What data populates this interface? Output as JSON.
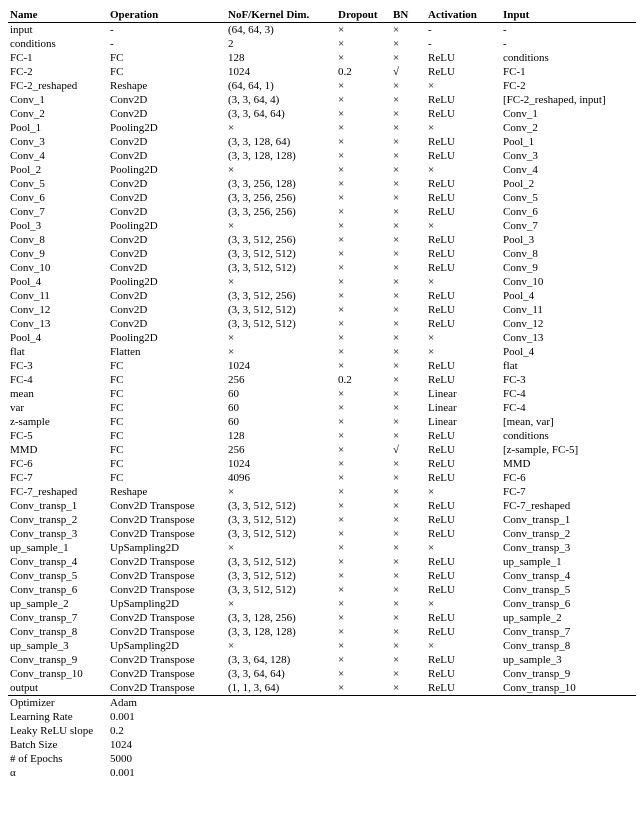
{
  "headers": {
    "name": "Name",
    "operation": "Operation",
    "nof": "NoF/Kernel Dim.",
    "dropout": "Dropout",
    "bn": "BN",
    "activation": "Activation",
    "input": "Input"
  },
  "rows": [
    {
      "name": "input",
      "op": "-",
      "nof": "(64, 64, 3)",
      "dropout": "×",
      "bn": "×",
      "act": "-",
      "inp": "-"
    },
    {
      "name": "conditions",
      "op": "-",
      "nof": "2",
      "dropout": "×",
      "bn": "×",
      "act": "-",
      "inp": "-"
    },
    {
      "name": "FC-1",
      "op": "FC",
      "nof": "128",
      "dropout": "×",
      "bn": "×",
      "act": "ReLU",
      "inp": "conditions"
    },
    {
      "name": "FC-2",
      "op": "FC",
      "nof": "1024",
      "dropout": "0.2",
      "bn": "√",
      "act": "ReLU",
      "inp": "FC-1"
    },
    {
      "name": "FC-2_reshaped",
      "op": "Reshape",
      "nof": "(64, 64, 1)",
      "dropout": "×",
      "bn": "×",
      "act": "×",
      "inp": "FC-2"
    },
    {
      "name": "Conv_1",
      "op": "Conv2D",
      "nof": "(3, 3, 64, 4)",
      "dropout": "×",
      "bn": "×",
      "act": "ReLU",
      "inp": "[FC-2_reshaped, input]"
    },
    {
      "name": "Conv_2",
      "op": "Conv2D",
      "nof": "(3, 3, 64, 64)",
      "dropout": "×",
      "bn": "×",
      "act": "ReLU",
      "inp": "Conv_1"
    },
    {
      "name": "Pool_1",
      "op": "Pooling2D",
      "nof": "×",
      "dropout": "×",
      "bn": "×",
      "act": "×",
      "inp": "Conv_2"
    },
    {
      "name": "Conv_3",
      "op": "Conv2D",
      "nof": "(3, 3, 128, 64)",
      "dropout": "×",
      "bn": "×",
      "act": "ReLU",
      "inp": "Pool_1"
    },
    {
      "name": "Conv_4",
      "op": "Conv2D",
      "nof": "(3, 3, 128, 128)",
      "dropout": "×",
      "bn": "×",
      "act": "ReLU",
      "inp": "Conv_3"
    },
    {
      "name": "Pool_2",
      "op": "Pooling2D",
      "nof": "×",
      "dropout": "×",
      "bn": "×",
      "act": "×",
      "inp": "Conv_4"
    },
    {
      "name": "Conv_5",
      "op": "Conv2D",
      "nof": "(3, 3, 256, 128)",
      "dropout": "×",
      "bn": "×",
      "act": "ReLU",
      "inp": "Pool_2"
    },
    {
      "name": "Conv_6",
      "op": "Conv2D",
      "nof": "(3, 3, 256, 256)",
      "dropout": "×",
      "bn": "×",
      "act": "ReLU",
      "inp": "Conv_5"
    },
    {
      "name": "Conv_7",
      "op": "Conv2D",
      "nof": "(3, 3, 256, 256)",
      "dropout": "×",
      "bn": "×",
      "act": "ReLU",
      "inp": "Conv_6"
    },
    {
      "name": "Pool_3",
      "op": "Pooling2D",
      "nof": "×",
      "dropout": "×",
      "bn": "×",
      "act": "×",
      "inp": "Conv_7"
    },
    {
      "name": "Conv_8",
      "op": "Conv2D",
      "nof": "(3, 3, 512, 256)",
      "dropout": "×",
      "bn": "×",
      "act": "ReLU",
      "inp": "Pool_3"
    },
    {
      "name": "Conv_9",
      "op": "Conv2D",
      "nof": "(3, 3, 512, 512)",
      "dropout": "×",
      "bn": "×",
      "act": "ReLU",
      "inp": "Conv_8"
    },
    {
      "name": "Conv_10",
      "op": "Conv2D",
      "nof": "(3, 3, 512, 512)",
      "dropout": "×",
      "bn": "×",
      "act": "ReLU",
      "inp": "Conv_9"
    },
    {
      "name": "Pool_4",
      "op": "Pooling2D",
      "nof": "×",
      "dropout": "×",
      "bn": "×",
      "act": "×",
      "inp": "Conv_10"
    },
    {
      "name": "Conv_11",
      "op": "Conv2D",
      "nof": "(3, 3, 512, 256)",
      "dropout": "×",
      "bn": "×",
      "act": "ReLU",
      "inp": "Pool_4"
    },
    {
      "name": "Conv_12",
      "op": "Conv2D",
      "nof": "(3, 3, 512, 512)",
      "dropout": "×",
      "bn": "×",
      "act": "ReLU",
      "inp": "Conv_11"
    },
    {
      "name": "Conv_13",
      "op": "Conv2D",
      "nof": "(3, 3, 512, 512)",
      "dropout": "×",
      "bn": "×",
      "act": "ReLU",
      "inp": "Conv_12"
    },
    {
      "name": "Pool_4",
      "op": "Pooling2D",
      "nof": "×",
      "dropout": "×",
      "bn": "×",
      "act": "×",
      "inp": "Conv_13"
    },
    {
      "name": "flat",
      "op": "Flatten",
      "nof": "×",
      "dropout": "×",
      "bn": "×",
      "act": "×",
      "inp": "Pool_4"
    },
    {
      "name": "FC-3",
      "op": "FC",
      "nof": "1024",
      "dropout": "×",
      "bn": "×",
      "act": "ReLU",
      "inp": "flat"
    },
    {
      "name": "FC-4",
      "op": "FC",
      "nof": "256",
      "dropout": "0.2",
      "bn": "×",
      "act": "ReLU",
      "inp": "FC-3"
    },
    {
      "name": "mean",
      "op": "FC",
      "nof": "60",
      "dropout": "×",
      "bn": "×",
      "act": "Linear",
      "inp": "FC-4"
    },
    {
      "name": "var",
      "op": "FC",
      "nof": "60",
      "dropout": "×",
      "bn": "×",
      "act": "Linear",
      "inp": "FC-4"
    },
    {
      "name": "z-sample",
      "op": "FC",
      "nof": "60",
      "dropout": "×",
      "bn": "×",
      "act": "Linear",
      "inp": "[mean, var]"
    },
    {
      "name": "FC-5",
      "op": "FC",
      "nof": "128",
      "dropout": "×",
      "bn": "×",
      "act": "ReLU",
      "inp": "conditions"
    },
    {
      "name": "MMD",
      "op": "FC",
      "nof": "256",
      "dropout": "×",
      "bn": "√",
      "act": "ReLU",
      "inp": "[z-sample, FC-5]"
    },
    {
      "name": "FC-6",
      "op": "FC",
      "nof": "1024",
      "dropout": "×",
      "bn": "×",
      "act": "ReLU",
      "inp": "MMD"
    },
    {
      "name": "FC-7",
      "op": "FC",
      "nof": "4096",
      "dropout": "×",
      "bn": "×",
      "act": "ReLU",
      "inp": "FC-6"
    },
    {
      "name": "FC-7_reshaped",
      "op": "Reshape",
      "nof": "×",
      "dropout": "×",
      "bn": "×",
      "act": "×",
      "inp": "FC-7"
    },
    {
      "name": "Conv_transp_1",
      "op": "Conv2D Transpose",
      "nof": "(3, 3, 512, 512)",
      "dropout": "×",
      "bn": "×",
      "act": "ReLU",
      "inp": "FC-7_reshaped"
    },
    {
      "name": "Conv_transp_2",
      "op": "Conv2D Transpose",
      "nof": "(3, 3, 512, 512)",
      "dropout": "×",
      "bn": "×",
      "act": "ReLU",
      "inp": "Conv_transp_1"
    },
    {
      "name": "Conv_transp_3",
      "op": "Conv2D Transpose",
      "nof": "(3, 3, 512, 512)",
      "dropout": "×",
      "bn": "×",
      "act": "ReLU",
      "inp": "Conv_transp_2"
    },
    {
      "name": "up_sample_1",
      "op": "UpSampling2D",
      "nof": "×",
      "dropout": "×",
      "bn": "×",
      "act": "×",
      "inp": "Conv_transp_3"
    },
    {
      "name": "Conv_transp_4",
      "op": "Conv2D Transpose",
      "nof": "(3, 3, 512, 512)",
      "dropout": "×",
      "bn": "×",
      "act": "ReLU",
      "inp": "up_sample_1"
    },
    {
      "name": "Conv_transp_5",
      "op": "Conv2D Transpose",
      "nof": "(3, 3, 512, 512)",
      "dropout": "×",
      "bn": "×",
      "act": "ReLU",
      "inp": "Conv_transp_4"
    },
    {
      "name": "Conv_transp_6",
      "op": "Conv2D Transpose",
      "nof": "(3, 3, 512, 512)",
      "dropout": "×",
      "bn": "×",
      "act": "ReLU",
      "inp": "Conv_transp_5"
    },
    {
      "name": "up_sample_2",
      "op": "UpSampling2D",
      "nof": "×",
      "dropout": "×",
      "bn": "×",
      "act": "×",
      "inp": "Conv_transp_6"
    },
    {
      "name": "Conv_transp_7",
      "op": "Conv2D Transpose",
      "nof": "(3, 3, 128, 256)",
      "dropout": "×",
      "bn": "×",
      "act": "ReLU",
      "inp": "up_sample_2"
    },
    {
      "name": "Conv_transp_8",
      "op": "Conv2D Transpose",
      "nof": "(3, 3, 128, 128)",
      "dropout": "×",
      "bn": "×",
      "act": "ReLU",
      "inp": "Conv_transp_7"
    },
    {
      "name": "up_sample_3",
      "op": "UpSampling2D",
      "nof": "×",
      "dropout": "×",
      "bn": "×",
      "act": "×",
      "inp": "Conv_transp_8"
    },
    {
      "name": "Conv_transp_9",
      "op": "Conv2D Transpose",
      "nof": "(3, 3, 64, 128)",
      "dropout": "×",
      "bn": "×",
      "act": "ReLU",
      "inp": "up_sample_3"
    },
    {
      "name": "Conv_transp_10",
      "op": "Conv2D Transpose",
      "nof": "(3, 3, 64, 64)",
      "dropout": "×",
      "bn": "×",
      "act": "ReLU",
      "inp": "Conv_transp_9"
    },
    {
      "name": "output",
      "op": "Conv2D Transpose",
      "nof": "(1, 1, 3, 64)",
      "dropout": "×",
      "bn": "×",
      "act": "ReLU",
      "inp": "Conv_transp_10"
    }
  ],
  "hyper": [
    {
      "k": "Optimizer",
      "v": "Adam"
    },
    {
      "k": "Learning Rate",
      "v": "0.001"
    },
    {
      "k": "Leaky ReLU slope",
      "v": "0.2"
    },
    {
      "k": "Batch Size",
      "v": "1024"
    },
    {
      "k": "# of Epochs",
      "v": "5000"
    },
    {
      "k": "α",
      "v": "0.001"
    }
  ]
}
